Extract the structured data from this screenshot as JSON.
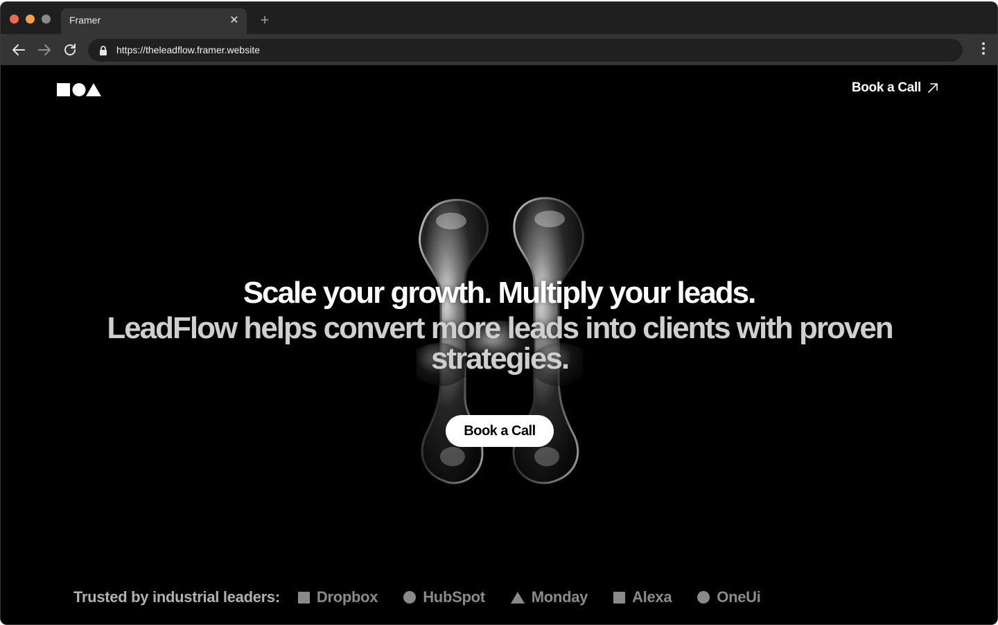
{
  "browser": {
    "tab_title": "Framer",
    "tab_close": "✕",
    "new_tab": "+",
    "url": "https://theleadflow.framer.website"
  },
  "nav": {
    "cta_label": "Book a Call"
  },
  "hero": {
    "headline": "Scale your growth. Multiply your leads.",
    "subheadline": "LeadFlow helps convert more leads into clients with proven strategies.",
    "cta_label": "Book a Call"
  },
  "trusted": {
    "label": "Trusted by industrial leaders:",
    "brands": [
      {
        "name": "Dropbox",
        "icon": "square"
      },
      {
        "name": "HubSpot",
        "icon": "circle"
      },
      {
        "name": "Monday",
        "icon": "triangle"
      },
      {
        "name": "Alexa",
        "icon": "square"
      },
      {
        "name": "OneUi",
        "icon": "circle"
      }
    ]
  },
  "colors": {
    "page_background": "#000000",
    "cta_background": "#ffffff",
    "traffic_red": "#ee6a4f",
    "traffic_yellow": "#f3a04a"
  }
}
